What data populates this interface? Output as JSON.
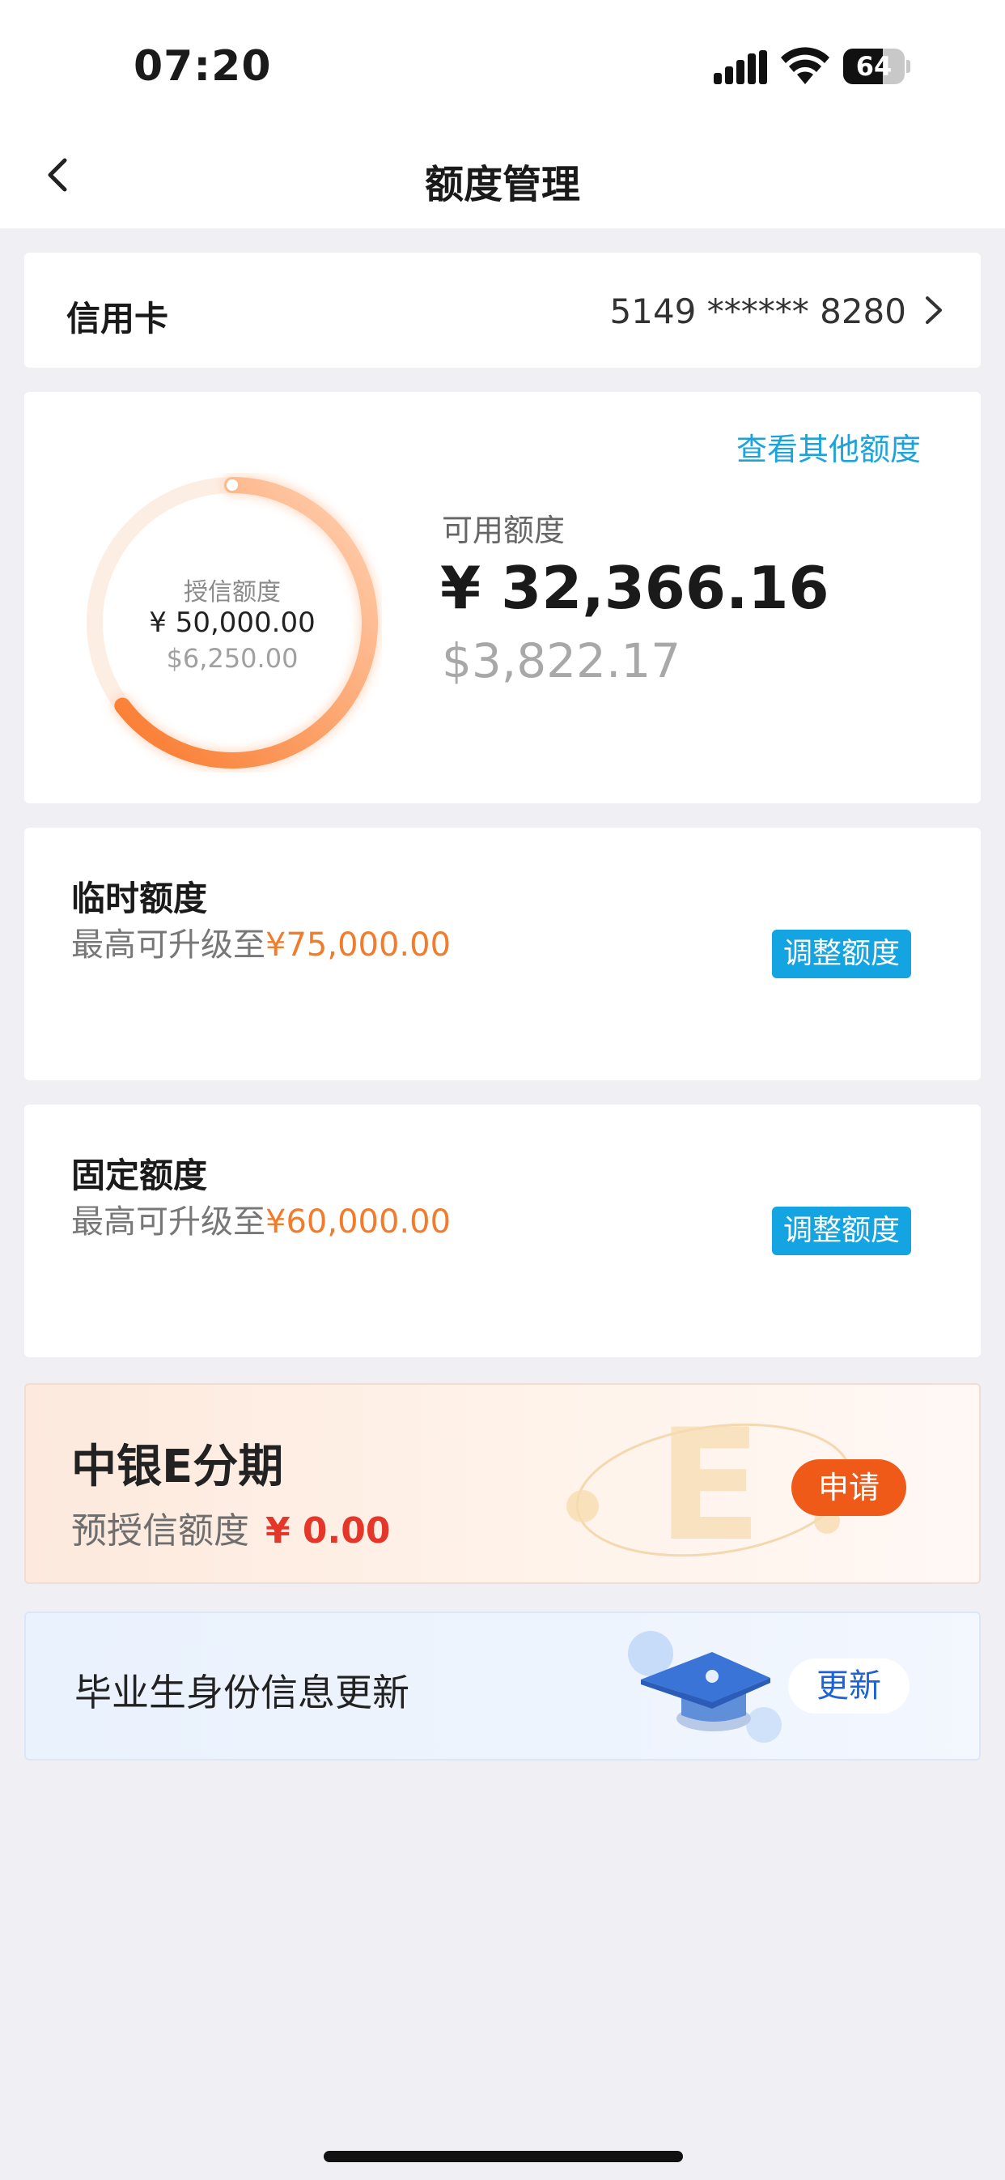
{
  "status_bar": {
    "time": "07:20",
    "battery_level": "64",
    "battery_fraction": 0.64,
    "icons": [
      "cellular-signal-icon",
      "wifi-icon",
      "battery-icon"
    ]
  },
  "nav": {
    "title": "额度管理",
    "back_icon": "chevron-left-icon"
  },
  "card_account": {
    "label": "信用卡",
    "number": "5149 ****** 8280",
    "chevron_icon": "chevron-right-icon"
  },
  "credit_summary": {
    "other_limits_link": "查看其他额度",
    "ring": {
      "label": "授信额度",
      "amount": "¥ 50,000.00",
      "usd_amount": "$6,250.00",
      "available_fraction": 0.647
    },
    "available_label": "可用额度",
    "available_amount": "¥ 32,366.16",
    "available_usd": "$3,822.17"
  },
  "temporary_limit": {
    "title": "临时额度",
    "desc_prefix": "最高可升级至",
    "desc_amount": "¥75,000.00",
    "button": "调整额度"
  },
  "fixed_limit": {
    "title": "固定额度",
    "desc_prefix": "最高可升级至",
    "desc_amount": "¥60,000.00",
    "button": "调整额度"
  },
  "installment": {
    "title": "中银E分期",
    "desc_prefix": "预授信额度",
    "desc_amount": "¥ 0.00",
    "button": "申请"
  },
  "graduate": {
    "title": "毕业生身份信息更新",
    "button": "更新"
  },
  "colors": {
    "accent_blue": "#14a4e2",
    "link_blue": "#1ba3dc",
    "orange": "#f17c2c",
    "apply_orange": "#f05a18",
    "red_amount": "#e4372a",
    "ring_start": "#f9792c",
    "ring_end": "#ffd3b5"
  }
}
